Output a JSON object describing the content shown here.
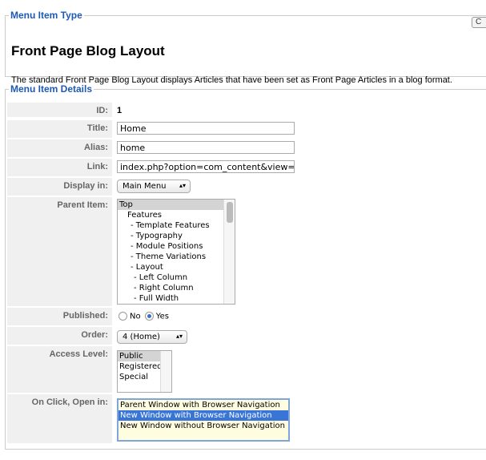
{
  "type_section": {
    "legend": "Menu Item Type",
    "title": "Front Page Blog Layout",
    "description": "The standard Front Page Blog Layout displays Articles that have been set as Front Page Articles in a blog format.",
    "change_button": "C"
  },
  "details": {
    "legend": "Menu Item Details",
    "id_label": "ID:",
    "id_value": "1",
    "title_label": "Title:",
    "title_value": "Home",
    "alias_label": "Alias:",
    "alias_value": "home",
    "link_label": "Link:",
    "link_value": "index.php?option=com_content&view=frontpage",
    "display_label": "Display in:",
    "display_value": "Main Menu",
    "parent_label": "Parent Item:",
    "parent_items": [
      "Top",
      "Features",
      "- Template Features",
      "- Typography",
      "- Module Positions",
      "- Theme Variations",
      "- Layout",
      "- Left Column",
      "- Right Column",
      "- Full Width"
    ],
    "parent_indent": [
      0,
      1,
      2,
      2,
      2,
      2,
      2,
      3,
      3,
      3
    ],
    "parent_selected": "Top",
    "published_label": "Published:",
    "published_no": "No",
    "published_yes": "Yes",
    "published_value": "Yes",
    "order_label": "Order:",
    "order_value": "4 (Home)",
    "access_label": "Access Level:",
    "access_items": [
      "Public",
      "Registered",
      "Special"
    ],
    "access_selected": "Public",
    "onclick_label": "On Click, Open in:",
    "onclick_items": [
      "Parent Window with Browser Navigation",
      "New Window with Browser Navigation",
      "New Window without Browser Navigation"
    ],
    "onclick_selected": "New Window with Browser Navigation"
  },
  "colors": {
    "legend": "#1d5ab4",
    "selection": "#3875d7",
    "focused_list_bg": "#fffde0"
  }
}
